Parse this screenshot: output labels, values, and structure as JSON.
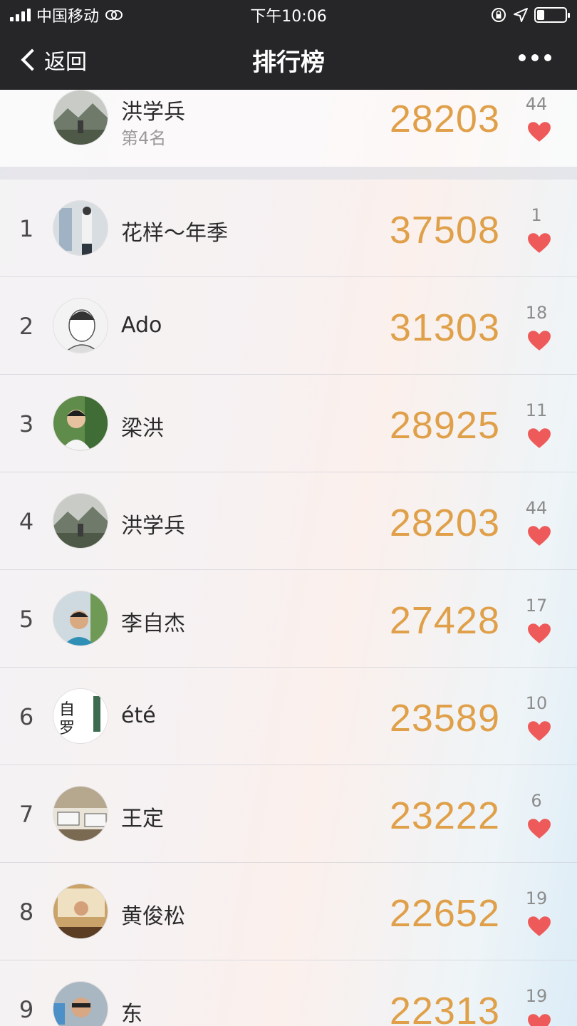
{
  "status_bar": {
    "carrier": "中国移动",
    "time": "下午10:06",
    "battery_level": 0.25,
    "icons": [
      "signal-icon",
      "wechat-link-icon",
      "rotation-lock-icon",
      "location-arrow-icon",
      "battery-icon"
    ]
  },
  "nav": {
    "back_label": "返回",
    "title": "排行榜",
    "more_icon": "more-dots-icon"
  },
  "colors": {
    "nav_bg": "#262628",
    "steps": "#e0a04a",
    "heart": "#ee5a5a"
  },
  "my_rank": {
    "name": "洪学兵",
    "rank_text": "第4名",
    "steps": "28203",
    "likes": "44"
  },
  "ranking": [
    {
      "rank": "1",
      "name": "花样～年季",
      "steps": "37508",
      "likes": "1"
    },
    {
      "rank": "2",
      "name": "Ado",
      "steps": "31303",
      "likes": "18"
    },
    {
      "rank": "3",
      "name": "梁洪",
      "steps": "28925",
      "likes": "11"
    },
    {
      "rank": "4",
      "name": "洪学兵",
      "steps": "28203",
      "likes": "44"
    },
    {
      "rank": "5",
      "name": "李自杰",
      "steps": "27428",
      "likes": "17"
    },
    {
      "rank": "6",
      "name": "été",
      "steps": "23589",
      "likes": "10"
    },
    {
      "rank": "7",
      "name": "王定",
      "steps": "23222",
      "likes": "6"
    },
    {
      "rank": "8",
      "name": "黄俊松",
      "steps": "22652",
      "likes": "19"
    },
    {
      "rank": "9",
      "name": "东",
      "steps": "22313",
      "likes": "19"
    }
  ]
}
